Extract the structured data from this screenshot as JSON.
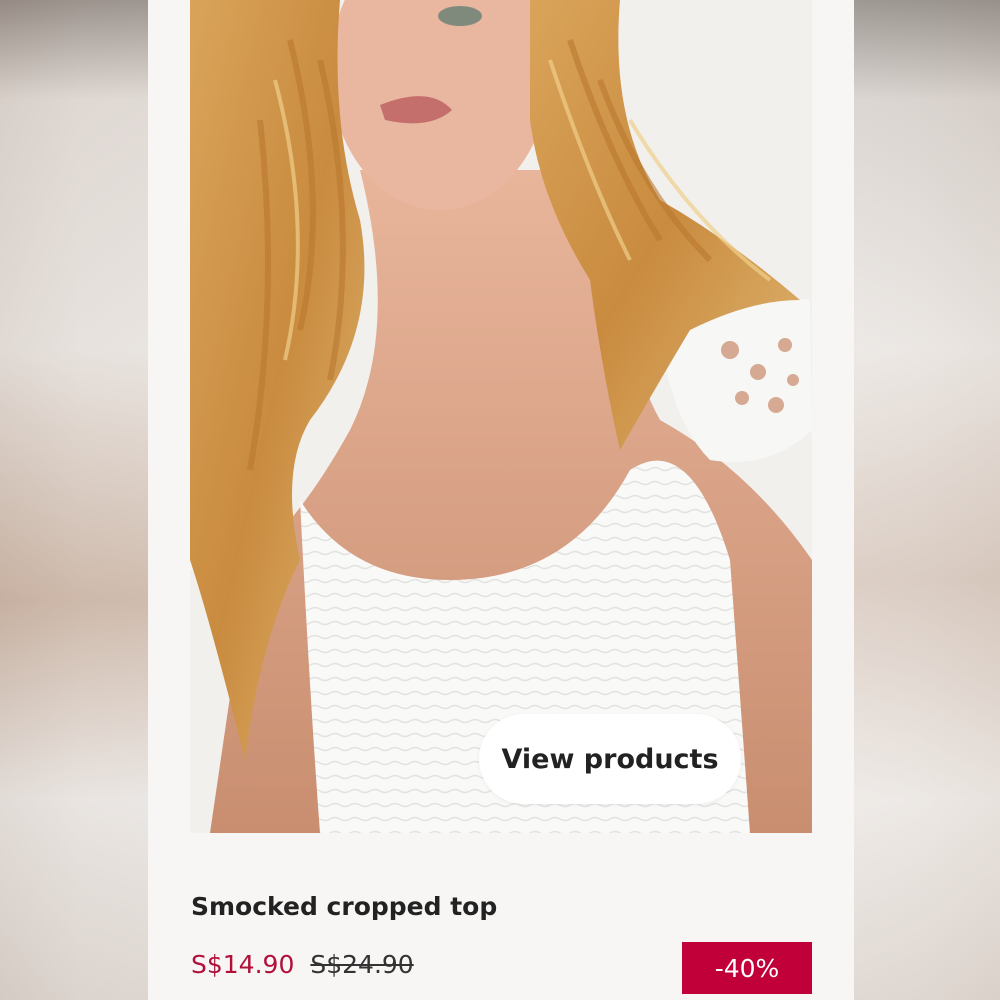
{
  "product": {
    "view_products_label": "View products",
    "title": "Smocked cropped top",
    "sale_price": "S$14.90",
    "original_price": "S$24.90",
    "discount": "-40%"
  },
  "colors": {
    "sale_price": "#b0103a",
    "discount_badge": "#c1003a",
    "card_background": "#f8f6f4"
  }
}
